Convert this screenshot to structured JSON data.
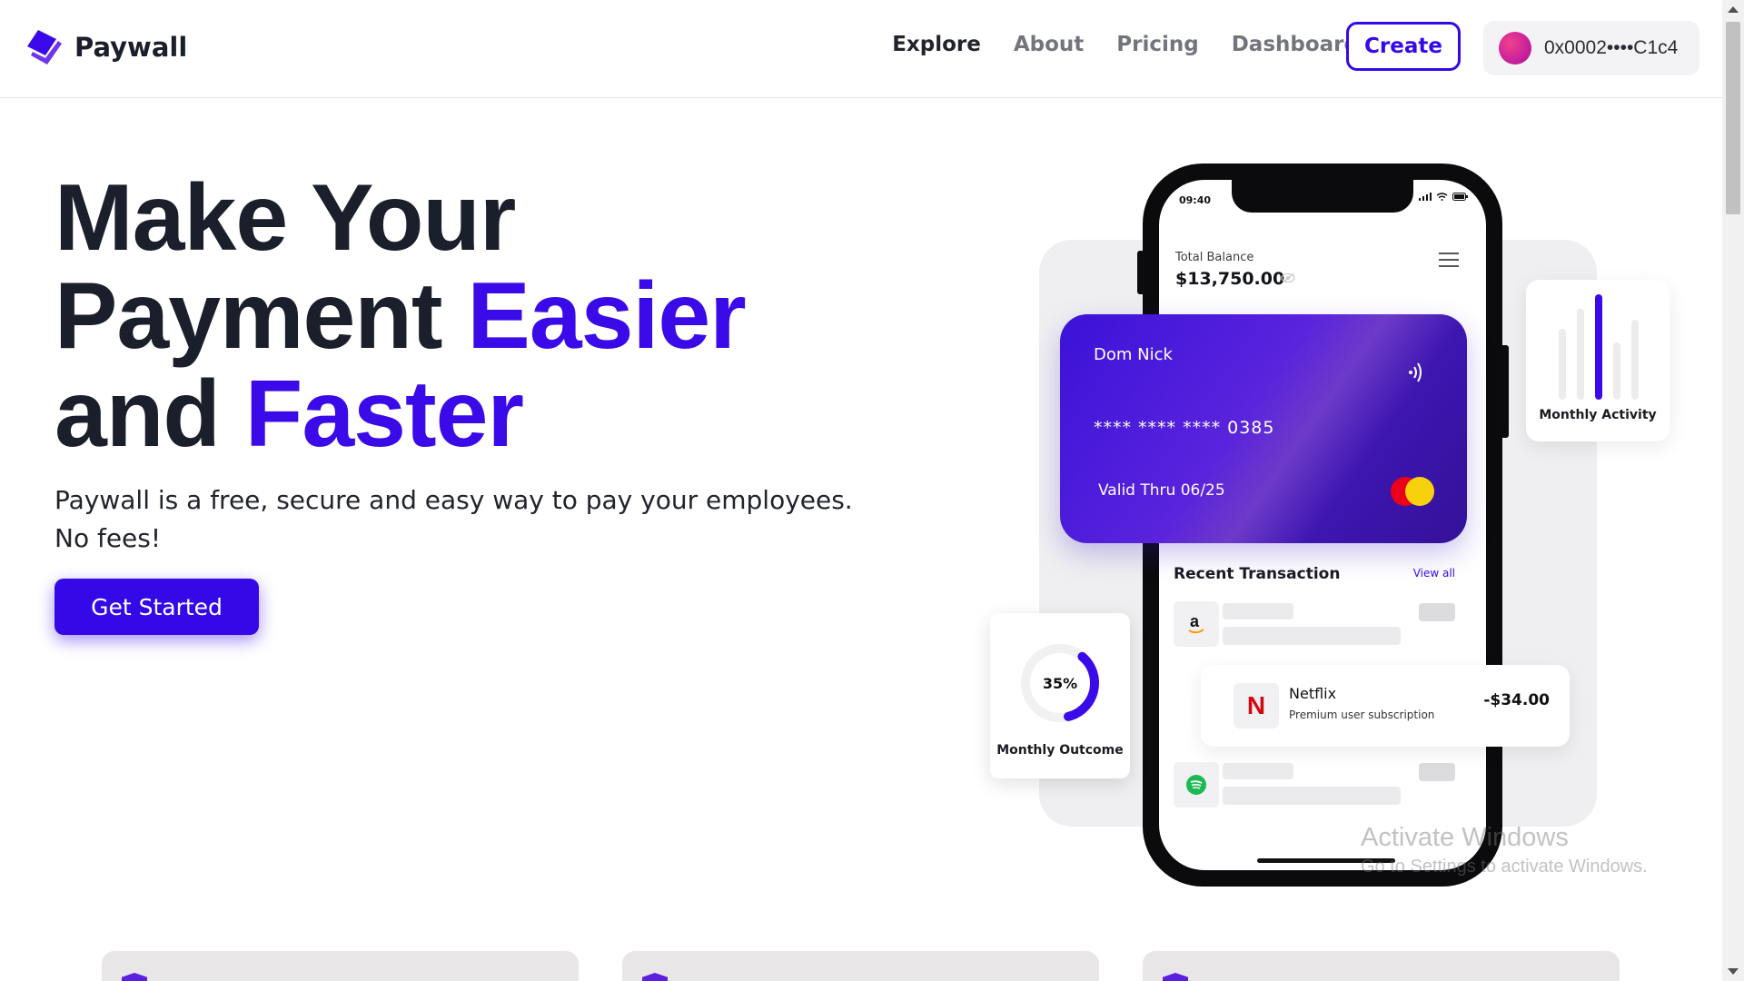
{
  "header": {
    "brand": "Paywall",
    "nav": [
      "Explore",
      "About",
      "Pricing",
      "Dashboard"
    ],
    "active_nav": "Explore",
    "create_label": "Create",
    "wallet_address": "0x0002••••C1c4"
  },
  "hero": {
    "title_line1": "Make Your",
    "title_line2_plain": "Payment ",
    "title_line2_accent": "Easier",
    "title_line3_plain": "and ",
    "title_line3_accent": "Faster",
    "subtitle": "Paywall is a free, secure and easy way to pay your employees. No fees!",
    "cta_label": "Get Started"
  },
  "phone": {
    "time": "09:40",
    "balance_label": "Total Balance",
    "balance_value": "$13,750.00",
    "recent_title": "Recent Transaction",
    "view_all": "View all",
    "tx_icons": [
      "amazon-icon",
      "spotify-icon"
    ]
  },
  "card": {
    "holder": "Dom Nick",
    "number": "****  ****  ****  0385",
    "valid": "Valid Thru   06/25"
  },
  "widgets": {
    "activity_label": "Monthly Activity",
    "outcome_percent": "35%",
    "outcome_fraction": 0.35,
    "outcome_label": "Monthly Outcome"
  },
  "transaction": {
    "name": "Netflix",
    "description": "Premium user subscription",
    "amount": "-$34.00"
  },
  "watermark": {
    "line1": "Activate Windows",
    "line2": "Go to Settings to activate Windows."
  },
  "colors": {
    "accent": "#3508e8",
    "text_dark": "#1b1f2b"
  }
}
